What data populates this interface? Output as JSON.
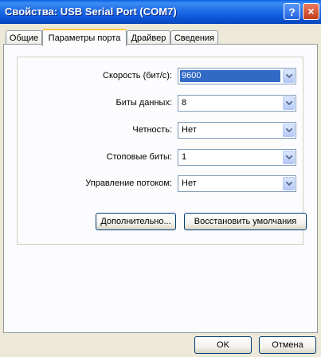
{
  "window": {
    "title": "Свойства: USB Serial Port (COM7)",
    "help_glyph": "?",
    "close_glyph": "×"
  },
  "tabs": [
    "Общие",
    "Параметры порта",
    "Драйвер",
    "Сведения"
  ],
  "port_settings": {
    "rows": [
      {
        "label": "Скорость (бит/с):",
        "value": "9600"
      },
      {
        "label": "Биты данных:",
        "value": "8"
      },
      {
        "label": "Четность:",
        "value": "Нет"
      },
      {
        "label": "Стоповые биты:",
        "value": "1"
      },
      {
        "label": "Управление потоком:",
        "value": "Нет"
      }
    ],
    "advanced_button": "Дополнительно...",
    "restore_button": "Восстановить умолчания"
  },
  "footer": {
    "ok": "OK",
    "cancel": "Отмена"
  },
  "colors": {
    "selection": "#316AC5",
    "tab_highlight": "#FFC83C",
    "title_bar": "#0A54D6"
  }
}
